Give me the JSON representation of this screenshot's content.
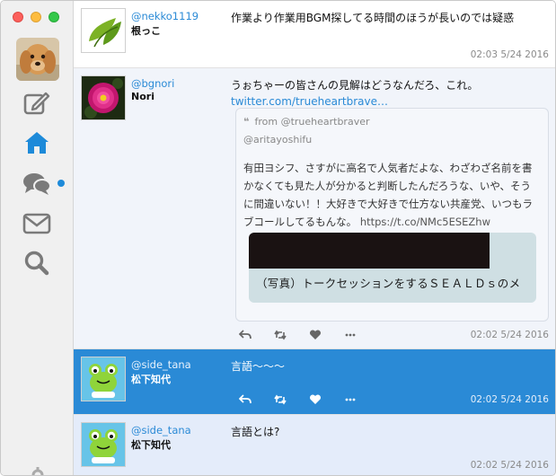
{
  "sidebar": {
    "nav": [
      {
        "name": "compose-icon"
      },
      {
        "name": "home-icon",
        "active": true
      },
      {
        "name": "chat-icon",
        "has_unread": true
      },
      {
        "name": "mail-icon"
      },
      {
        "name": "search-icon"
      }
    ],
    "colors": {
      "active": "#1d8ad9",
      "inactive": "#7a7a7a"
    }
  },
  "timeline": {
    "tweets": [
      {
        "handle": "@nekko1119",
        "name": "根っこ",
        "text": "作業より作業用BGM探してる時間のほうが長いのでは疑惑",
        "time": "02:03 5/24 2016"
      },
      {
        "handle": "@bgnori",
        "name": "Nori",
        "text": "うぉちゃーの皆さんの見解はどうなんだろ、これ。",
        "link": "twitter.com/trueheartbrave…",
        "quote": {
          "from": "from @trueheartbraver",
          "handle": "@aritayoshifu",
          "text": "有田ヨシフ、さすがに高名で人気者だよな、わざわざ名前を書かなくても見た人が分かると判断したんだろうな、いや、そうに間違いない！！大好きで大好きで仕方ない共産党、いつもラブコールしてるもんな。",
          "link": "https://t.co/NMc5ESEZhw",
          "media_caption": "（写真）トークセッションをするＳＥＡＬＤｓのメ"
        },
        "time": "02:02 5/24 2016"
      },
      {
        "handle": "@side_tana",
        "name": "松下知代",
        "text": "言語〜〜〜",
        "time": "02:02 5/24 2016",
        "selected": true
      },
      {
        "handle": "@side_tana",
        "name": "松下知代",
        "text": "言語とは?",
        "time": "02:02 5/24 2016"
      }
    ]
  },
  "actions": [
    "reply-icon",
    "retweet-icon",
    "like-icon",
    "more-icon"
  ]
}
